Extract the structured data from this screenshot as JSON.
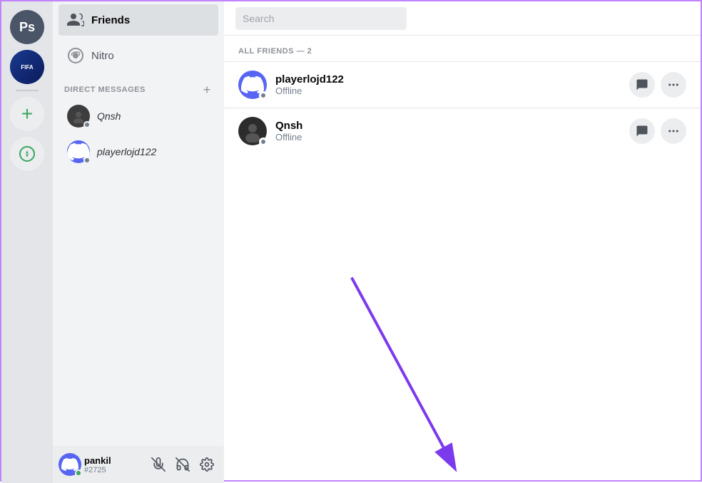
{
  "app": {
    "title": "Discord",
    "border_color": "#c084fc"
  },
  "server_sidebar": {
    "servers": [
      {
        "id": "ps",
        "label": "Ps",
        "type": "text"
      },
      {
        "id": "fifa",
        "label": "FIFA",
        "type": "fifa"
      }
    ],
    "add_label": "+",
    "explore_label": "🧭"
  },
  "dm_sidebar": {
    "friends_label": "Friends",
    "nitro_label": "Nitro",
    "direct_messages_label": "DIRECT MESSAGES",
    "add_dm_label": "+",
    "dm_users": [
      {
        "id": "qnsh",
        "name": "Qnsh",
        "status": "offline",
        "avatar_type": "dark"
      },
      {
        "id": "playerlojd122",
        "name": "playerlojd122",
        "status": "offline",
        "avatar_type": "discord"
      }
    ]
  },
  "user_bar": {
    "name": "pankil",
    "tag": "#2725",
    "status": "online",
    "mute_label": "Mute",
    "deafen_label": "Deafen",
    "settings_label": "User Settings"
  },
  "main": {
    "search_placeholder": "Search",
    "friends_count_label": "ALL FRIENDS — 2",
    "friends": [
      {
        "id": "playerlojd122",
        "name": "playerlojd122",
        "status": "Offline",
        "avatar_type": "discord"
      },
      {
        "id": "qnsh",
        "name": "Qnsh",
        "status": "Offline",
        "avatar_type": "dark"
      }
    ]
  },
  "annotation": {
    "arrow_color": "#7c3aed"
  }
}
